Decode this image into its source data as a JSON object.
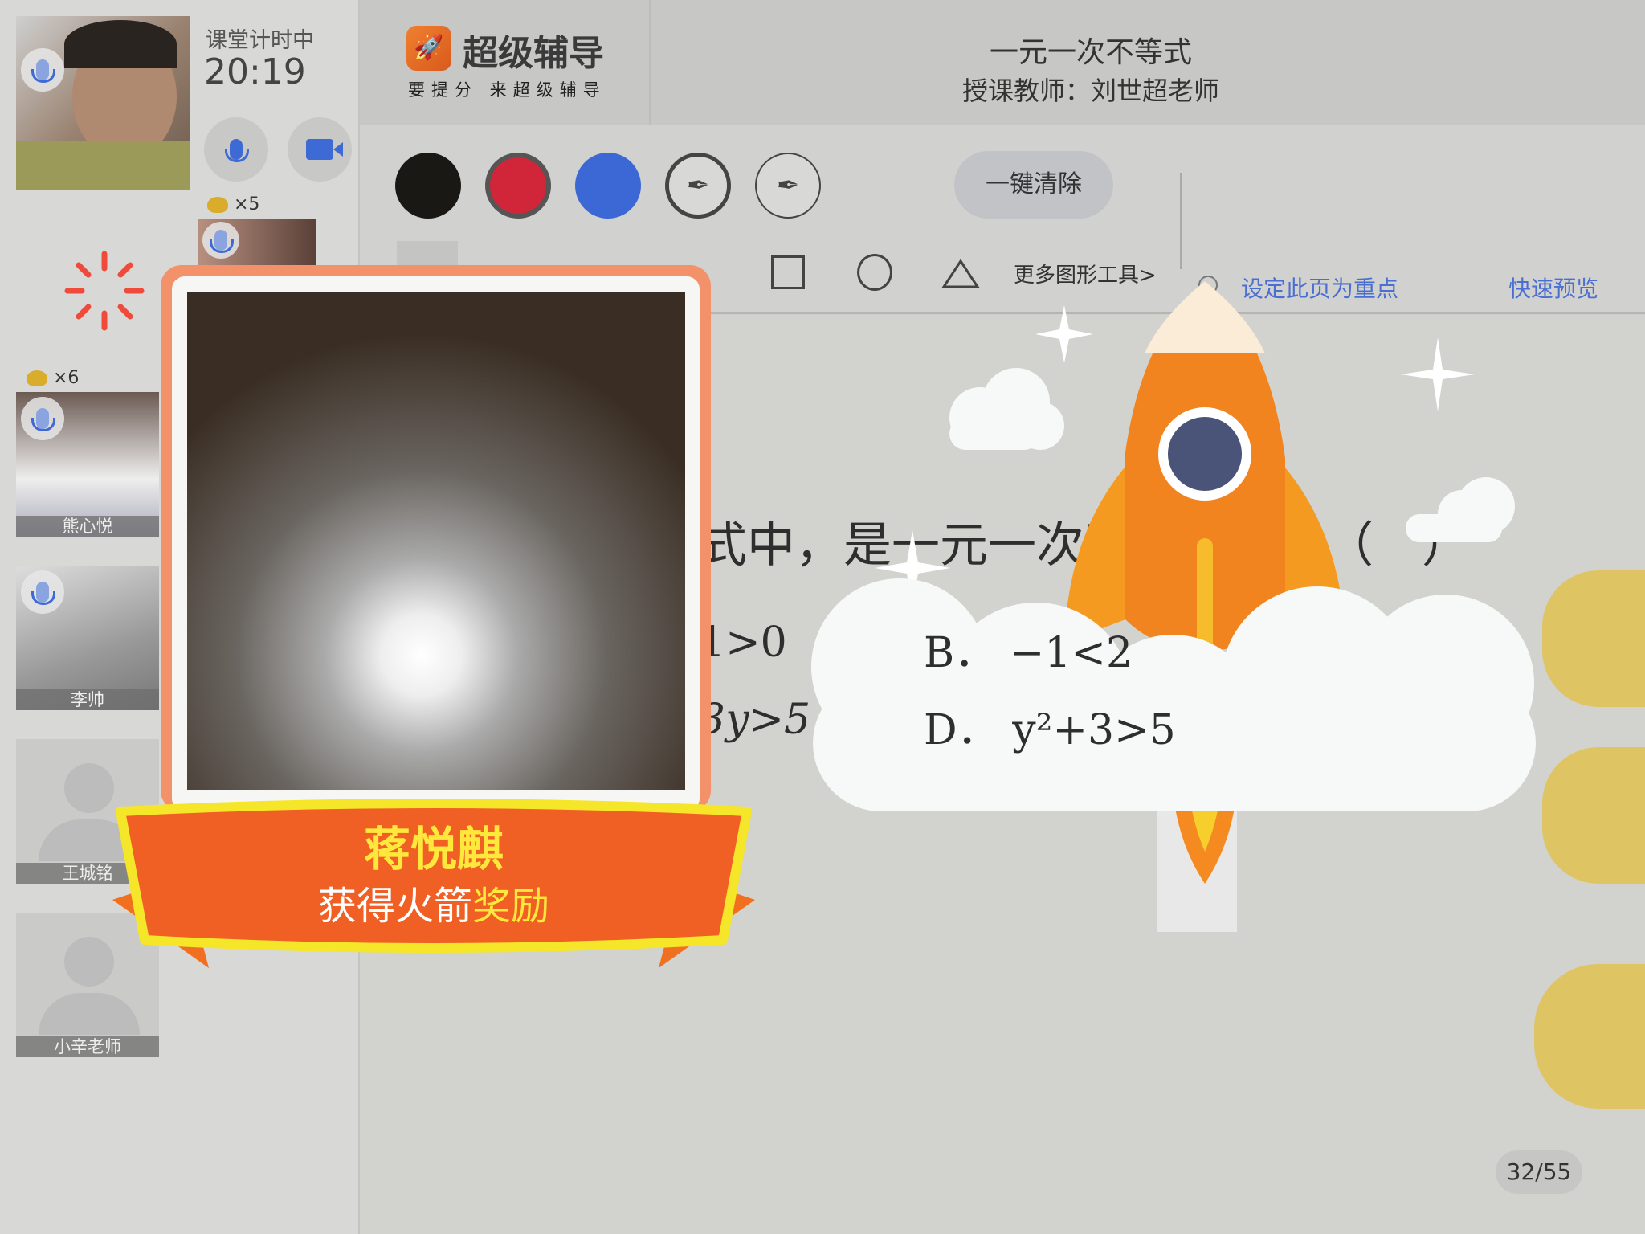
{
  "teacher_panel": {
    "timer_label": "课堂计时中",
    "timer": "20:19",
    "trophy_count_1": "×5",
    "trophy_count_2": "×6"
  },
  "students": [
    {
      "name": "熊心悦"
    },
    {
      "name": "李帅"
    },
    {
      "name": "王城铭"
    },
    {
      "name": "小辛老师"
    }
  ],
  "header": {
    "brand": "超级辅导",
    "slogan": "要提分 来超级辅导",
    "title": "一元一次不等式",
    "teacher": "授课教师：刘世超老师"
  },
  "toolbar": {
    "colors": [
      "#1a1814",
      "#d1253a",
      "#3b68d4"
    ],
    "clear_label": "一键清除",
    "more_shapes": "更多图形工具>",
    "set_key_page": "设定此页为重点",
    "quick_preview": "快速预览"
  },
  "slide": {
    "question": "式中，是一元一次不等式的是（　）",
    "option_a": "1>0",
    "option_b": "B． −1<2",
    "option_c": "3y>5",
    "option_d": "D． y²+3>5",
    "page": "32/55"
  },
  "reward": {
    "student": "蒋悦麒",
    "text_prefix": "获得火箭",
    "text_suffix": "奖励"
  }
}
